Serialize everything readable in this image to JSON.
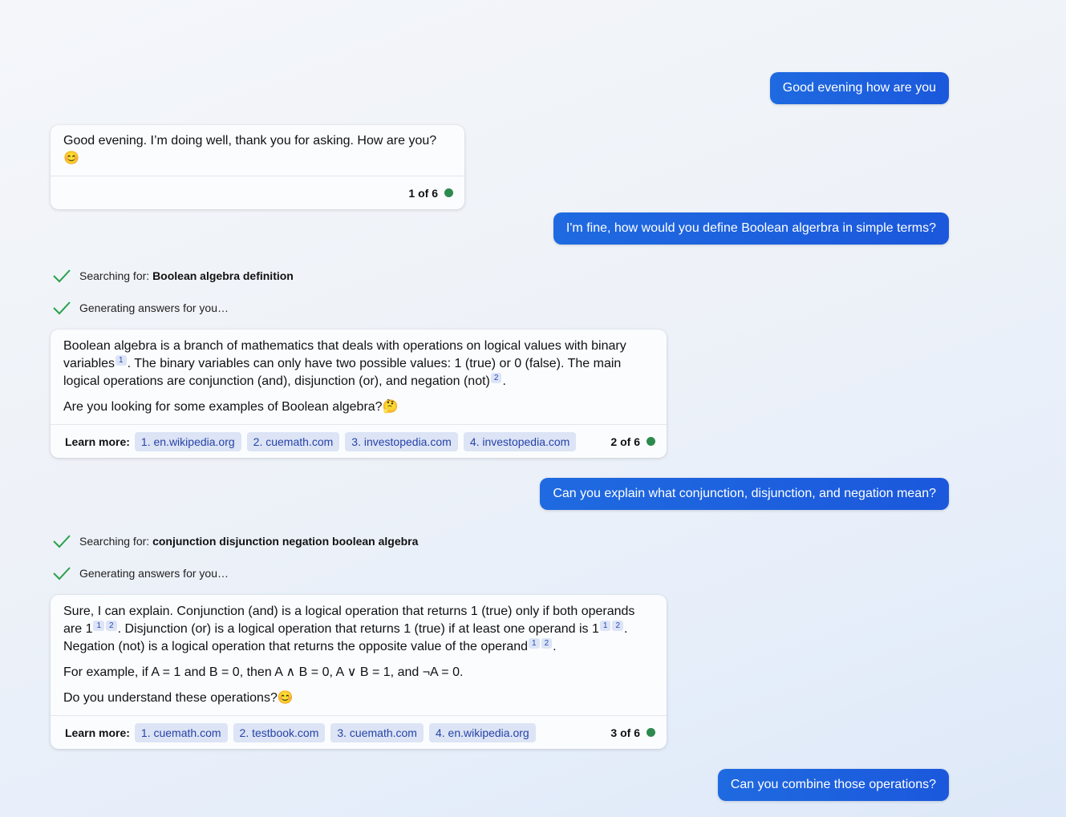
{
  "messages": {
    "user1": "Good evening how are you",
    "bot1": {
      "text": "Good evening. I’m doing well, thank you for asking. How are you?",
      "emoji": "😊",
      "counter": "1 of 6"
    },
    "user2": "I'm fine, how would you define Boolean algerbra in simple terms?",
    "status2": {
      "search_prefix": "Searching for:",
      "search_query": "Boolean algebra definition",
      "generating": "Generating answers for you…"
    },
    "bot2": {
      "p1_a": "Boolean algebra is a branch of mathematics that deals with operations on logical values with binary variables",
      "p1_b": ". The binary variables can only have two possible values: 1 (true) or 0 (false). The main logical operations are conjunction (and), disjunction (or), and negation (not)",
      "p1_c": ".",
      "p2": "Are you looking for some examples of Boolean algebra?",
      "p2_emoji": "🤔",
      "learn_more": "Learn more:",
      "links": [
        "1. en.wikipedia.org",
        "2. cuemath.com",
        "3. investopedia.com",
        "4. investopedia.com"
      ],
      "counter": "2 of 6"
    },
    "user3": "Can you explain what conjunction, disjunction, and negation mean?",
    "status3": {
      "search_prefix": "Searching for:",
      "search_query": "conjunction disjunction negation boolean algebra",
      "generating": "Generating answers for you…"
    },
    "bot3": {
      "p1_a": "Sure, I can explain. Conjunction (and) is a logical operation that returns 1 (true) only if both operands are 1",
      "p1_b": ". Disjunction (or) is a logical operation that returns 1 (true) if at least one operand is 1",
      "p1_c": ". Negation (not) is a logical operation that returns the opposite value of the operand",
      "p1_d": ".",
      "p2": "For example, if A = 1 and B = 0, then A ∧ B = 0, A ∨ B = 1, and ¬A = 0.",
      "p3": "Do you understand these operations?",
      "p3_emoji": "😊",
      "learn_more": "Learn more:",
      "links": [
        "1. cuemath.com",
        "2. testbook.com",
        "3. cuemath.com",
        "4. en.wikipedia.org"
      ],
      "counter": "3 of 6"
    },
    "user4": "Can you combine those operations?"
  },
  "citations": [
    "1",
    "2"
  ],
  "colors": {
    "user_bubble": "#1b5fe0",
    "check": "#2aa04a",
    "status_dot": "#2d8a4e",
    "chip_bg": "#dce4f5",
    "chip_text": "#2743a8"
  },
  "icons": {
    "check": "check-icon",
    "status_dot": "status-dot-icon"
  }
}
